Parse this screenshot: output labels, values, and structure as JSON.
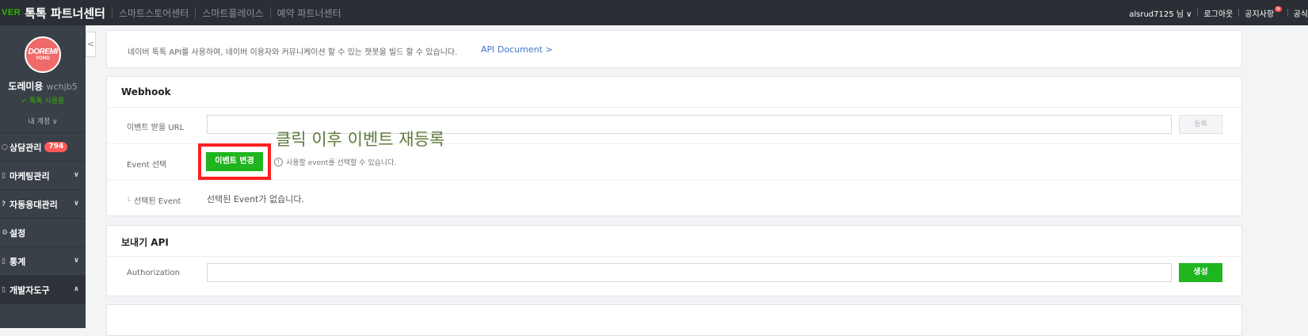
{
  "topbar": {
    "brand_prefix": "VER",
    "brand_title": "톡톡 파트너센터",
    "nav": [
      "스마트스토어센터",
      "스마트플레이스",
      "예약 파트너센터"
    ],
    "user": "alsrud7125 님 ∨",
    "logout": "로그아웃",
    "notice": "공지사항",
    "notice_badge": "N",
    "more": "공식"
  },
  "sidebar": {
    "logo_line1": "DOREMI",
    "logo_line2": "YONG",
    "profile_name": "도레미용",
    "profile_id": "wchjb5",
    "profile_status": "톡톡 사용중",
    "account_toggle": "내 계정 ∨",
    "menu": [
      {
        "label": "상담관리",
        "badge": "794",
        "icon": "○"
      },
      {
        "label": "마케팅관리",
        "icon": "▯"
      },
      {
        "label": "자동응대관리",
        "icon": "?"
      },
      {
        "label": "설정",
        "icon": "⚙"
      },
      {
        "label": "통계",
        "icon": "▯"
      },
      {
        "label": "개발자도구",
        "icon": "▯"
      }
    ]
  },
  "info": {
    "text": "네이버 톡톡 API를 사용하여, 네이버 이용자와 커뮤니케이션 할 수 있는 챗봇을 빌드 할 수 있습니다.",
    "api_link": "API Document >"
  },
  "webhook": {
    "title": "Webhook",
    "url_label": "이벤트 받을 URL",
    "url_value": "",
    "register_button": "등록",
    "event_label": "Event 선택",
    "event_button": "이벤트 변경",
    "hint": "사용할 event를 선택할 수 있습니다.",
    "annotation": "클릭 이후 이벤트 재등록",
    "selected_label": "선택된 Event",
    "selected_value": "선택된 Event가 없습니다."
  },
  "send_api": {
    "title": "보내기 API",
    "auth_label": "Authorization",
    "auth_value": "",
    "create_button": "생성"
  },
  "colors": {
    "accent_green": "#1fb51f",
    "highlight_red": "#ff2020",
    "badge_red": "#ff5a5a",
    "sidebar_bg": "#3a4048",
    "topbar_bg": "#2b2f35"
  }
}
